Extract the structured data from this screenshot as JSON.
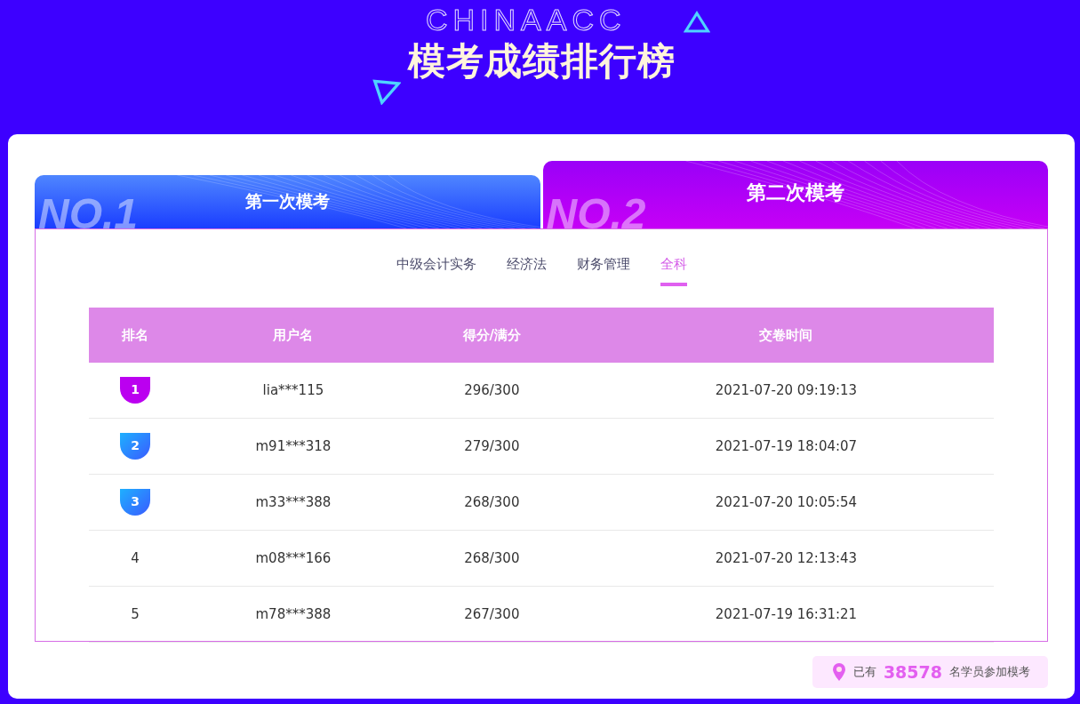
{
  "header": {
    "title": "模考成绩排行榜",
    "backdrop_text": "CHINAACC"
  },
  "exam_tabs": [
    {
      "label": "第一次模考",
      "number_text": "NO.1",
      "selected": false,
      "kind": "blue"
    },
    {
      "label": "第二次模考",
      "number_text": "NO.2",
      "selected": true,
      "kind": "purple"
    }
  ],
  "subject_tabs": [
    {
      "label": "中级会计实务",
      "selected": false
    },
    {
      "label": "经济法",
      "selected": false
    },
    {
      "label": "财务管理",
      "selected": false
    },
    {
      "label": "全科",
      "selected": true
    }
  ],
  "table": {
    "columns": [
      "排名",
      "用户名",
      "得分/满分",
      "交卷时间"
    ],
    "rows": [
      {
        "rank": "1",
        "kind": "first",
        "user": "lia***115",
        "score": "296/300",
        "time": "2021-07-20 09:19:13"
      },
      {
        "rank": "2",
        "kind": "top",
        "user": "m91***318",
        "score": "279/300",
        "time": "2021-07-19 18:04:07"
      },
      {
        "rank": "3",
        "kind": "top",
        "user": "m33***388",
        "score": "268/300",
        "time": "2021-07-20 10:05:54"
      },
      {
        "rank": "4",
        "kind": "plain",
        "user": "m08***166",
        "score": "268/300",
        "time": "2021-07-20 12:13:43"
      },
      {
        "rank": "5",
        "kind": "plain",
        "user": "m78***388",
        "score": "267/300",
        "time": "2021-07-19 16:31:21"
      }
    ]
  },
  "participants": {
    "prefix": "已有",
    "count": "38578",
    "suffix": "名学员参加模考"
  }
}
